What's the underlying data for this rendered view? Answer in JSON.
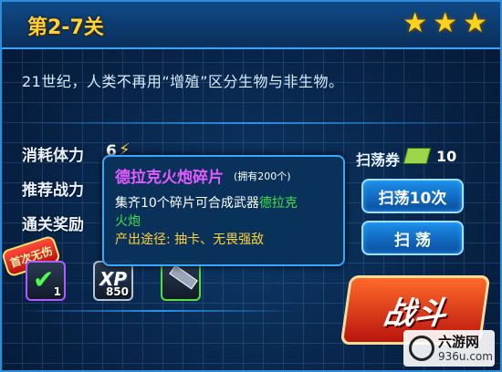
{
  "header": {
    "stage_title": "第2-7关",
    "stars": [
      "★",
      "★",
      "★"
    ]
  },
  "description": "21世纪，人类不再用“增殖”区分生物与非生物。",
  "stats": {
    "stamina_label": "消耗体力",
    "stamina_value": "6",
    "recommended_label": "推荐战力",
    "reward_label": "通关奖励"
  },
  "rewards": {
    "first_clear_badge": "首次无伤",
    "items": [
      {
        "icon": "cannon-shard-icon",
        "count": "1"
      },
      {
        "icon": "xp-icon",
        "text": "XP",
        "count": "850"
      },
      {
        "icon": "weapon-icon",
        "count": ""
      }
    ]
  },
  "sweep": {
    "ticket_label": "扫荡券",
    "ticket_count": "10",
    "sweep10_label": "扫荡10次",
    "sweep_label": "扫 荡"
  },
  "fight_button": "战斗",
  "tooltip": {
    "title": "德拉克火炮碎片",
    "owned": "(拥有200个)",
    "line1_prefix": "集齐10个碎片可合成武器",
    "line1_highlight": "德拉克",
    "line2_highlight": "火炮",
    "line3_label": "产出途径:",
    "line3_value": "抽卡、无畏强敌"
  },
  "watermark": {
    "site": "六游网",
    "url": "936u.com"
  },
  "colors": {
    "accent": "#38a6ff",
    "gold": "#ffd23a",
    "purple": "#e35bff",
    "green": "#3fe04b"
  }
}
